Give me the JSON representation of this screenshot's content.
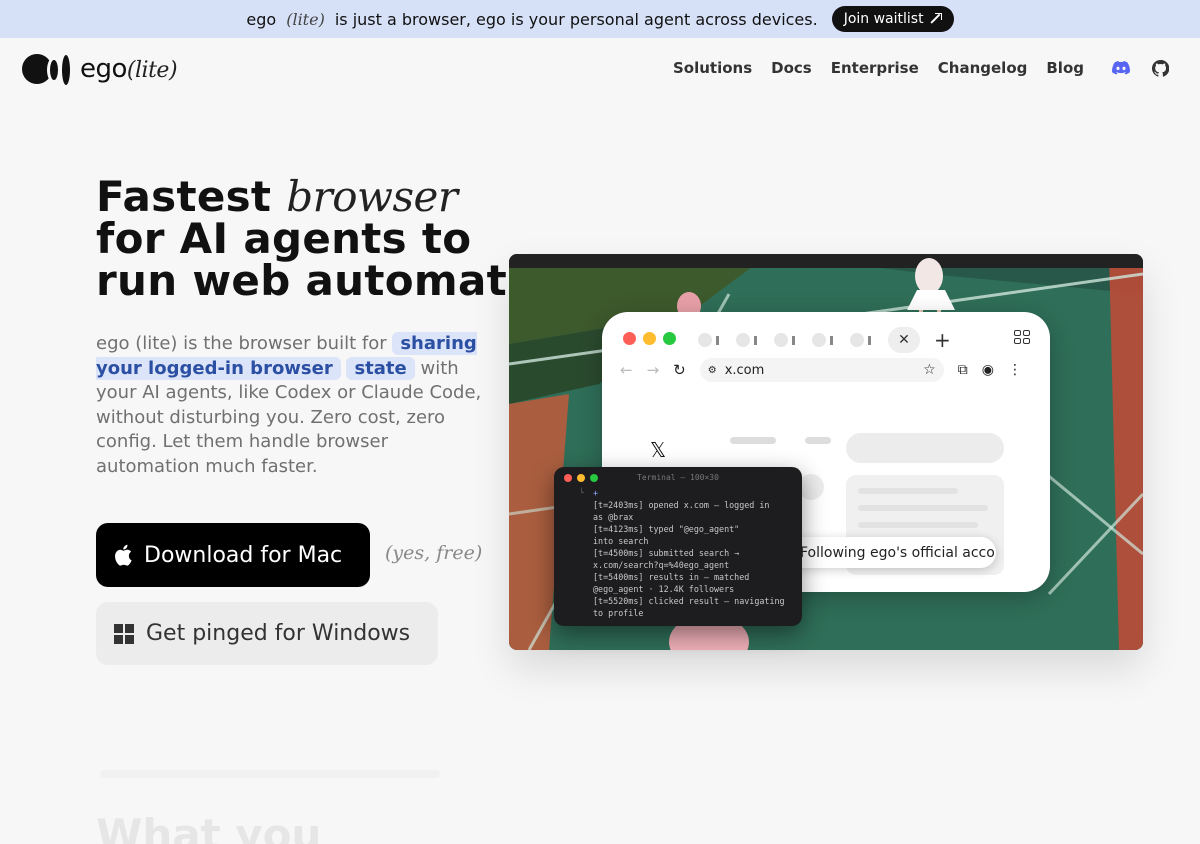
{
  "banner": {
    "text_prefix": "ego",
    "text_lite": "(lite)",
    "text_suffix": "is just a browser, ego is your personal agent across devices.",
    "cta_label": "Join waitlist"
  },
  "header": {
    "logo_name": "ego",
    "logo_lite": "(lite)",
    "nav": [
      "Solutions",
      "Docs",
      "Enterprise",
      "Changelog",
      "Blog"
    ],
    "icons": [
      "discord-icon",
      "github-icon"
    ]
  },
  "hero": {
    "title_line1_bold": "Fastest",
    "title_line1_italic": "browser",
    "title_line2": "for AI agents to",
    "title_line3": "run web automation",
    "desc_part1": "ego (lite) is the browser built for",
    "desc_highlight1": "sharing your logged-in browser",
    "desc_highlight2": "state",
    "desc_part2": "with your AI agents, like Codex or Claude Code, without disturbing you. Zero cost, zero config. Let them handle browser automation much faster.",
    "mac_button": "Download for Mac",
    "free_note": "(yes, free)",
    "windows_button": "Get pinged for Windows"
  },
  "mockup": {
    "url": "x.com",
    "x_logo": "𝕏",
    "toast": "Following ego's official account",
    "terminal_title": "Terminal — 100×30",
    "terminal_prompt": "+",
    "terminal_lines": [
      "[t=2403ms] opened x.com — logged in",
      "as @brax",
      "[t=4123ms] typed \"@ego_agent\"",
      "into search",
      "[t=4500ms] submitted search →",
      "x.com/search?q=%40ego_agent",
      "[t=5400ms] results in — matched",
      "@ego_agent · 12.4K followers",
      "[t=5520ms] clicked result — navigating",
      "to profile"
    ]
  },
  "below_fold": {
    "heading": "What you"
  },
  "colors": {
    "banner_bg": "#d6e0f7",
    "highlight_bg": "#dbe4f8",
    "highlight_text": "#2b4fa3",
    "court_green": "#2e6b55"
  }
}
